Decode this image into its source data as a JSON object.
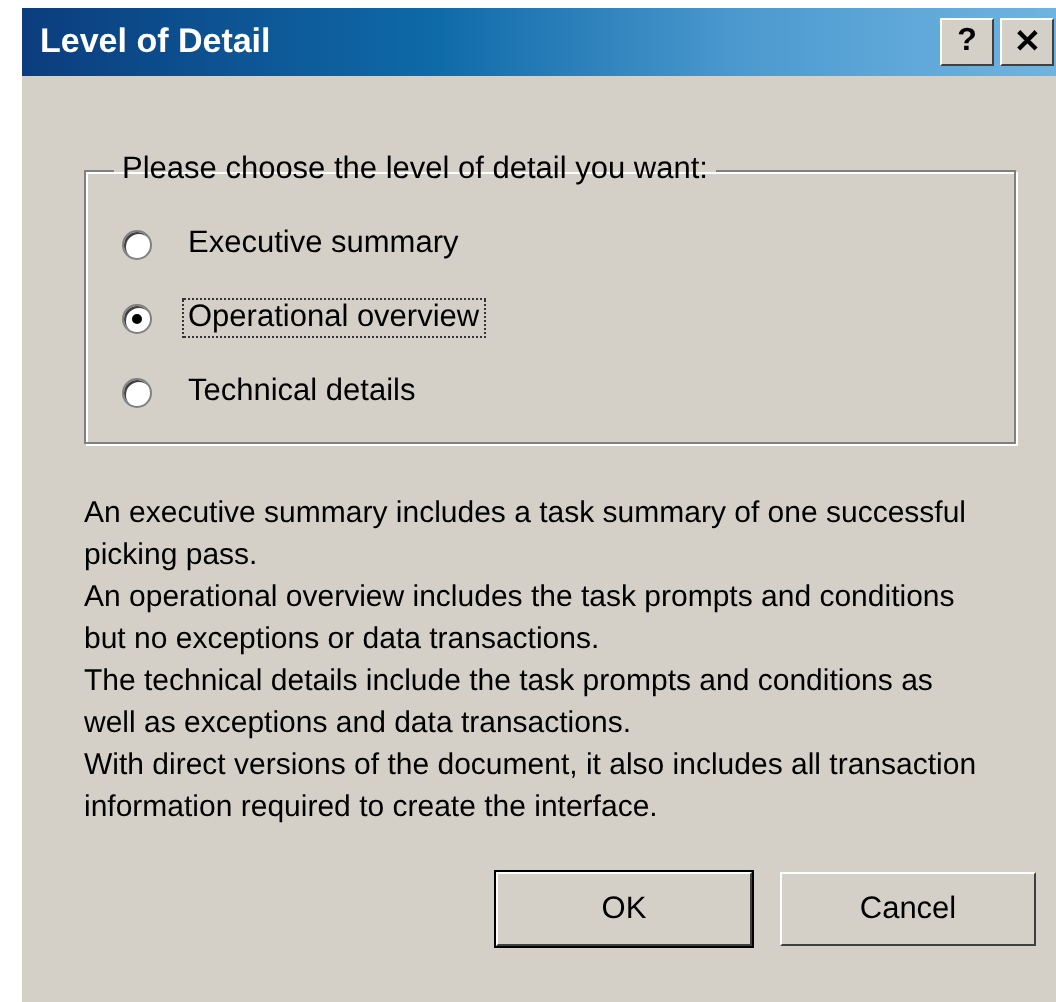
{
  "window": {
    "title": "Level of Detail",
    "title_buttons": [
      "?",
      "✕"
    ]
  },
  "group": {
    "label": "Please choose the level of detail you want:",
    "options": [
      {
        "label": "Executive summary",
        "selected": false
      },
      {
        "label": "Operational overview",
        "selected": true
      },
      {
        "label": "Technical details",
        "selected": false
      }
    ]
  },
  "description": [
    "An executive summary includes a task summary of one successful picking pass.",
    "An operational overview includes the task prompts and conditions but no exceptions or data transactions.",
    "The technical details include the task prompts and conditions as well as exceptions and data transactions.",
    "With direct versions of the document, it also includes all transaction information required to create the interface."
  ],
  "buttons": [
    {
      "label": "OK",
      "default": true
    },
    {
      "label": "Cancel",
      "default": false
    }
  ]
}
